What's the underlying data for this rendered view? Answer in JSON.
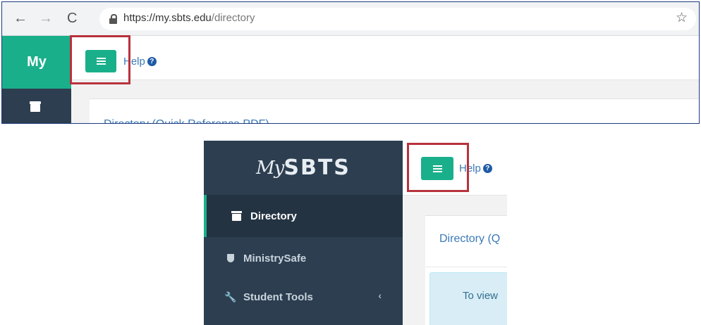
{
  "browser": {
    "url_host": "https://my.sbts.edu",
    "url_path": "/directory"
  },
  "top_app": {
    "brand": "My",
    "help_label": "Help",
    "card_title": "Directory (Quick Reference PDF)"
  },
  "bottom_app": {
    "brand_script": "My",
    "brand_bold": "SBTS",
    "help_label": "Help",
    "sidebar": {
      "items": [
        {
          "label": "Directory"
        },
        {
          "label": "MinistrySafe"
        },
        {
          "label": "Student Tools"
        }
      ]
    },
    "card_title": "Directory (Q",
    "info_text": "To view"
  },
  "colors": {
    "accent": "#1aaf8b",
    "sidebar": "#2c3e50",
    "highlight": "#b8323c",
    "link": "#3a7ab7"
  }
}
